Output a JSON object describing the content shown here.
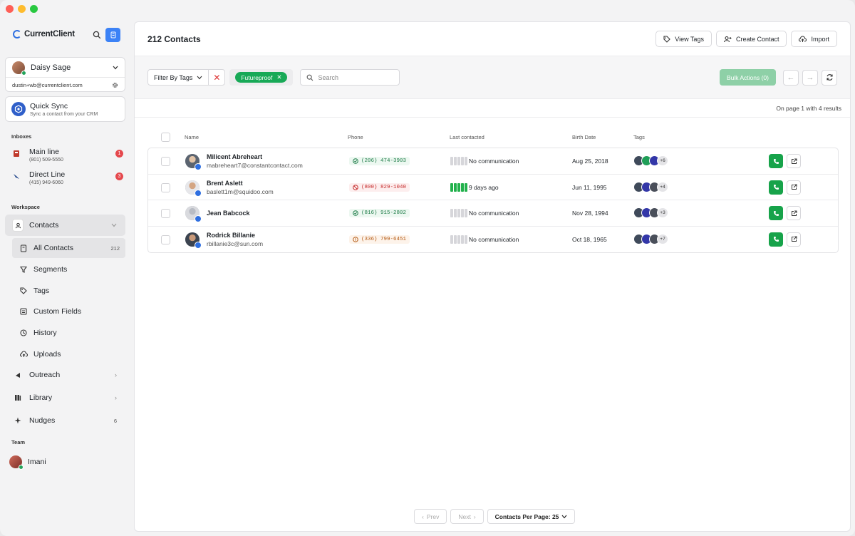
{
  "app": {
    "brand": "CurrentClient"
  },
  "user": {
    "name": "Daisy Sage",
    "email": "dustin+wb@currentclient.com"
  },
  "quick_sync": {
    "title": "Quick Sync",
    "subtitle": "Sync a contact from your CRM"
  },
  "inboxes": {
    "label": "Inboxes",
    "items": [
      {
        "title": "Main line",
        "phone": "(801) 509-5550",
        "badge": "1"
      },
      {
        "title": "Direct Line",
        "phone": "(415) 949-6060",
        "badge": "3"
      }
    ]
  },
  "workspace": {
    "label": "Workspace",
    "contacts": "Contacts",
    "sub": [
      {
        "label": "All Contacts",
        "count": "212"
      },
      {
        "label": "Segments"
      },
      {
        "label": "Tags"
      },
      {
        "label": "Custom Fields"
      },
      {
        "label": "History"
      },
      {
        "label": "Uploads"
      }
    ],
    "outreach": "Outreach",
    "library": "Library",
    "nudges": "Nudges",
    "nudges_count": "6"
  },
  "team": {
    "label": "Team",
    "member": "Imani"
  },
  "header": {
    "title": "212 Contacts",
    "view_tags": "View Tags",
    "create_contact": "Create Contact",
    "import": "Import"
  },
  "toolbar": {
    "filter_label": "Filter By Tags",
    "tag": "Futureproof",
    "search_placeholder": "Search",
    "bulk_actions": "Bulk Actions (0)"
  },
  "results": "On page 1 with 4 results",
  "columns": {
    "name": "Name",
    "phone": "Phone",
    "last_contacted": "Last contacted",
    "birth_date": "Birth Date",
    "tags": "Tags"
  },
  "rows": [
    {
      "name": "Milicent Abreheart",
      "email": "mabreheart7@constantcontact.com",
      "phone": "(206) 474-3903",
      "phone_status": "valid",
      "last_contacted": "No communication",
      "activity_level": 0,
      "birth_date": "Aug 25, 2018",
      "tag_more": "+6"
    },
    {
      "name": "Brent Aslett",
      "email": "baslett1m@squidoo.com",
      "phone": "(800) 829-1040",
      "phone_status": "blocked",
      "last_contacted": "9 days ago",
      "activity_level": 5,
      "birth_date": "Jun 11, 1995",
      "tag_more": "+4"
    },
    {
      "name": "Jean Babcock",
      "email": "",
      "phone": "(816) 915-2802",
      "phone_status": "valid",
      "last_contacted": "No communication",
      "activity_level": 0,
      "birth_date": "Nov 28, 1994",
      "tag_more": "+3"
    },
    {
      "name": "Rodrick Billanie",
      "email": "rbillanie3c@sun.com",
      "phone": "(336) 799-6451",
      "phone_status": "warning",
      "last_contacted": "No communication",
      "activity_level": 0,
      "birth_date": "Oct 18, 1965",
      "tag_more": "+7"
    }
  ],
  "pagination": {
    "prev": "Prev",
    "next": "Next",
    "per_page": "Contacts Per Page: 25"
  },
  "colors": {
    "accent": "#3c82f6",
    "green": "#17a34a",
    "tag_green": "#18a957"
  }
}
